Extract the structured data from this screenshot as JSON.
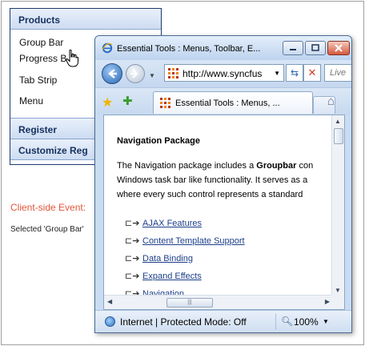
{
  "groupbar": {
    "sections": [
      {
        "label": "Products"
      },
      {
        "label": "Register"
      },
      {
        "label": "Customize Reg"
      }
    ],
    "items": [
      {
        "label": "Group Bar"
      },
      {
        "label": "Progress B"
      },
      {
        "label": "Tab Strip"
      },
      {
        "label": "Menu"
      }
    ]
  },
  "event": {
    "label": "Client-side Event:",
    "value": "Selected 'Group Bar'"
  },
  "browser": {
    "title": "Essential Tools : Menus, Toolbar, E...",
    "address": "http://www.syncfus",
    "search_placeholder": "Live",
    "tab_label": "Essential Tools : Menus, ...",
    "status": "Internet | Protected Mode: Off",
    "zoom": "100%",
    "icons": {
      "back": "back-arrow-icon",
      "forward": "forward-arrow-icon",
      "refresh": "refresh-icon",
      "stop": "stop-icon",
      "favorites": "star-icon",
      "add_favorites": "add-favorites-icon",
      "home": "home-icon",
      "internet": "globe-icon",
      "zoom": "magnifier-icon"
    }
  },
  "content": {
    "heading": "Navigation Package",
    "paragraph_lines": [
      "The Navigation package includes a Groupbar con",
      "Windows task bar like functionality. It serves as a",
      "where every such control represents a standard"
    ],
    "links": [
      {
        "label": "AJAX Features"
      },
      {
        "label": "Content Template Support"
      },
      {
        "label": "Data Binding"
      },
      {
        "label": "Expand Effects"
      },
      {
        "label": "Navigation"
      }
    ],
    "link_arrow_glyph": "⊏➔"
  },
  "colors": {
    "groupbar_header_text": "#15305e",
    "event_label": "#e0553a",
    "link": "#1d3f8a"
  }
}
